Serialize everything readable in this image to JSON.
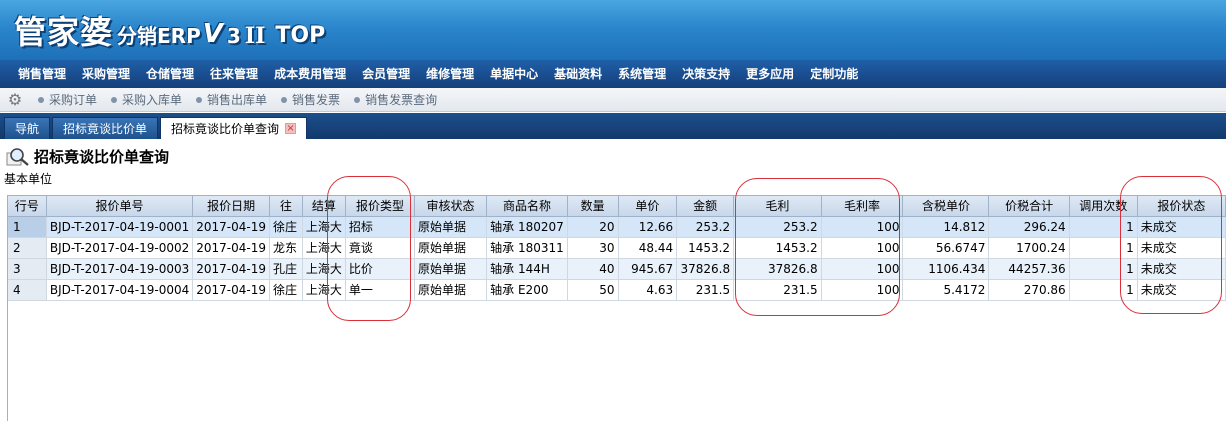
{
  "banner": {
    "brand_main": "管家婆",
    "brand_sub": "分销ERP",
    "brand_v": "V",
    "brand_num": "3",
    "brand_roman": "II",
    "brand_top": "TOP"
  },
  "menu": [
    "销售管理",
    "采购管理",
    "仓储管理",
    "往来管理",
    "成本费用管理",
    "会员管理",
    "维修管理",
    "单据中心",
    "基础资料",
    "系统管理",
    "决策支持",
    "更多应用",
    "定制功能"
  ],
  "quick_links": [
    "采购订单",
    "采购入库单",
    "销售出库单",
    "销售发票",
    "销售发票查询"
  ],
  "tabs": [
    {
      "label": "导航"
    },
    {
      "label": "招标竟谈比价单"
    },
    {
      "label": "招标竟谈比价单查询",
      "active": true
    }
  ],
  "page": {
    "title": "招标竟谈比价单查询",
    "unit_label": "基本单位"
  },
  "table": {
    "columns": [
      "行号",
      "报价单号",
      "报价日期",
      "往",
      "结算",
      "报价类型",
      "审核状态",
      "商品名称",
      "数量",
      "单价",
      "金额",
      "毛利",
      "毛利率",
      "含税单价",
      "价税合计",
      "调用次数",
      "报价状态"
    ],
    "rows": [
      [
        "1",
        "BJD-T-2017-04-19-0001",
        "2017-04-19",
        "徐庄",
        "上海大",
        "招标",
        "原始单据",
        "轴承  180207",
        "20",
        "12.66",
        "253.2",
        "253.2",
        "100",
        "14.812",
        "296.24",
        "1",
        "未成交"
      ],
      [
        "2",
        "BJD-T-2017-04-19-0002",
        "2017-04-19",
        "龙东",
        "上海大",
        "竟谈",
        "原始单据",
        "轴承  180311",
        "30",
        "48.44",
        "1453.2",
        "1453.2",
        "100",
        "56.6747",
        "1700.24",
        "1",
        "未成交"
      ],
      [
        "3",
        "BJD-T-2017-04-19-0003",
        "2017-04-19",
        "孔庄",
        "上海大",
        "比价",
        "原始单据",
        "轴承  144H",
        "40",
        "945.67",
        "37826.8",
        "37826.8",
        "100",
        "1106.434",
        "44257.36",
        "1",
        "未成交"
      ],
      [
        "4",
        "BJD-T-2017-04-19-0004",
        "2017-04-19",
        "徐庄",
        "上海大",
        "单一",
        "原始单据",
        "轴承  E200",
        "50",
        "4.63",
        "231.5",
        "231.5",
        "100",
        "5.4172",
        "270.86",
        "1",
        "未成交"
      ]
    ]
  },
  "colors": {
    "annotation_ring": "#d9303a",
    "selected_row": "#d4e6f8",
    "header_blue": "#2b86cc"
  }
}
